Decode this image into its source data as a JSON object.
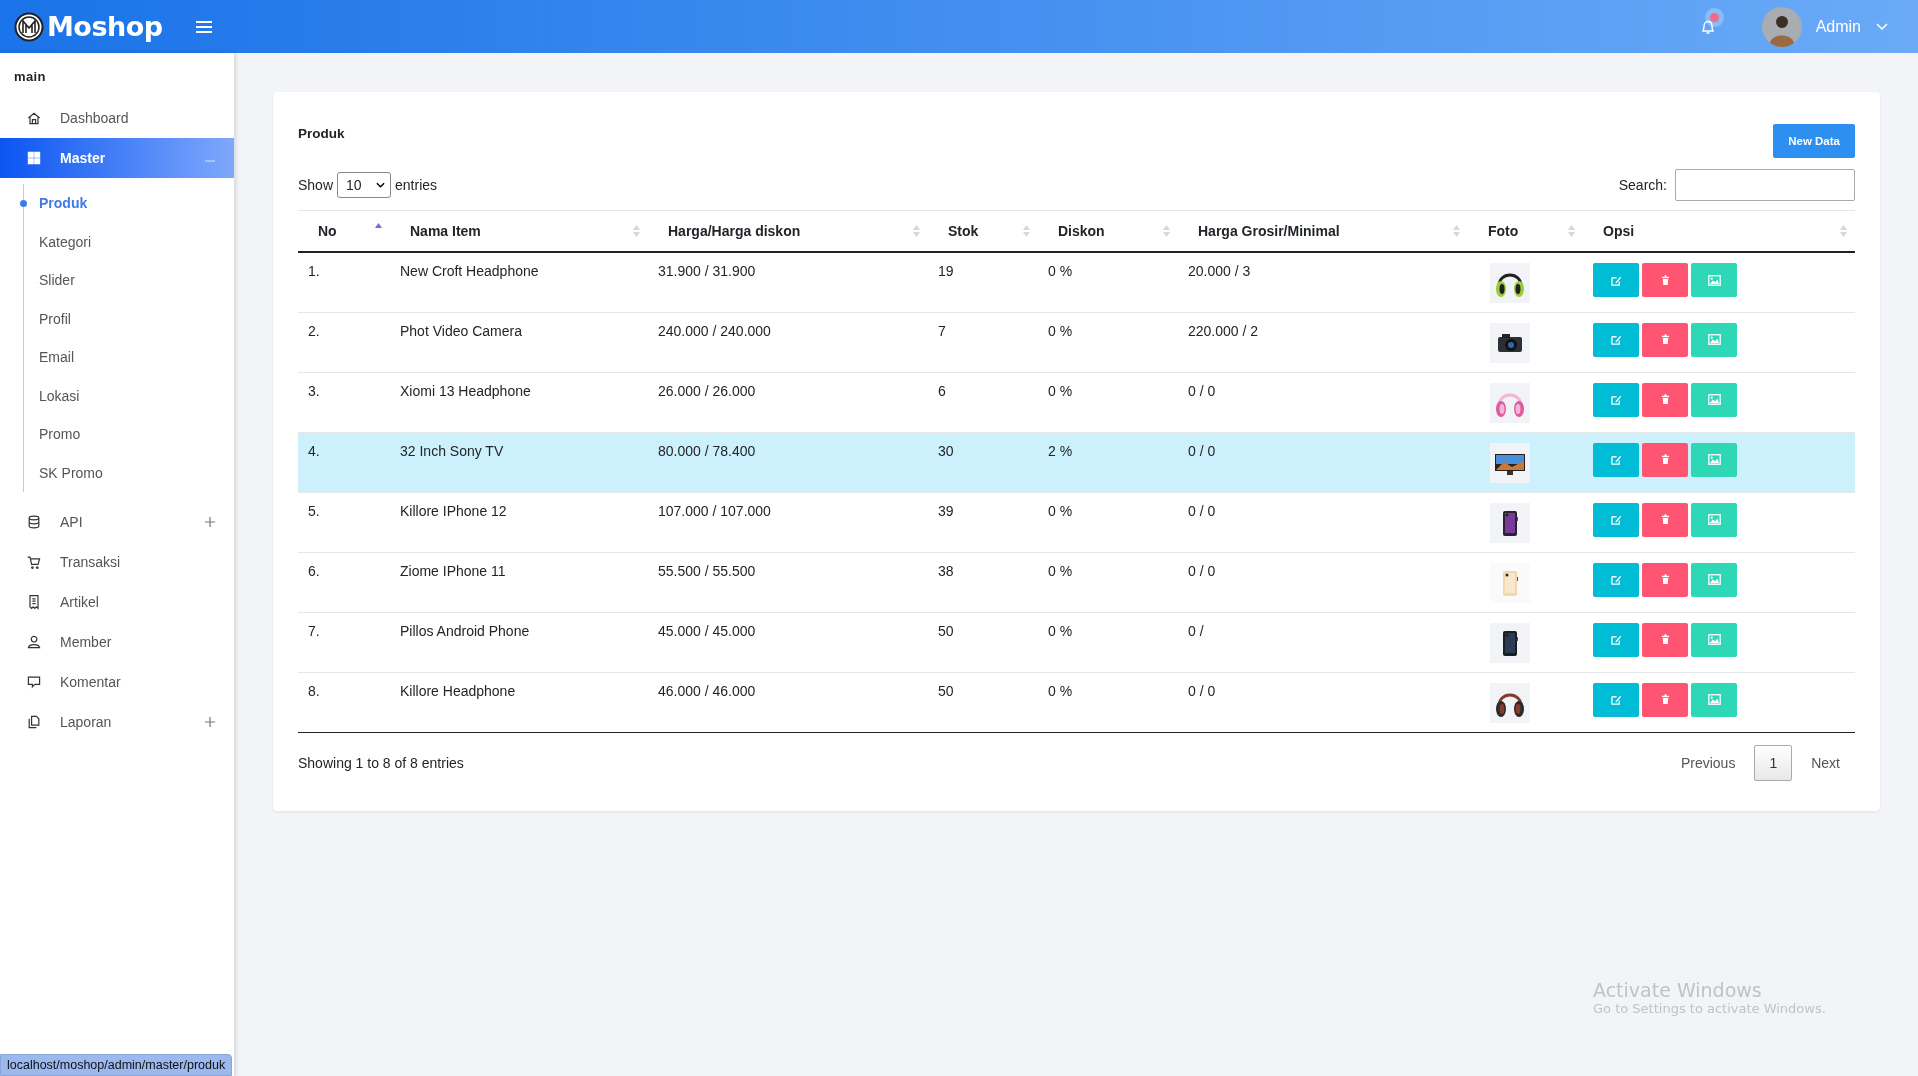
{
  "header": {
    "logo_text": "Moshop",
    "user_name": "Admin",
    "notification_unread": true
  },
  "sidebar": {
    "section_label": "main",
    "items": [
      {
        "label": "Dashboard",
        "selected": false
      },
      {
        "label": "Master",
        "selected": true,
        "expanded": true,
        "children": [
          {
            "label": "Produk",
            "selected": true
          },
          {
            "label": "Kategori",
            "selected": false
          },
          {
            "label": "Slider",
            "selected": false
          },
          {
            "label": "Profil",
            "selected": false
          },
          {
            "label": "Email",
            "selected": false
          },
          {
            "label": "Lokasi",
            "selected": false
          },
          {
            "label": "Promo",
            "selected": false
          },
          {
            "label": "SK Promo",
            "selected": false
          }
        ]
      },
      {
        "label": "API",
        "selected": false,
        "expanded": false
      },
      {
        "label": "Transaksi",
        "selected": false
      },
      {
        "label": "Artikel",
        "selected": false
      },
      {
        "label": "Member",
        "selected": false
      },
      {
        "label": "Komentar",
        "selected": false
      },
      {
        "label": "Laporan",
        "selected": false,
        "expanded": false
      }
    ]
  },
  "card": {
    "title": "Produk",
    "new_button": "New Data",
    "length_before": "Show",
    "length_value": "10",
    "length_after": "entries",
    "search_label": "Search:",
    "columns": [
      {
        "label": "No",
        "sorted": true
      },
      {
        "label": "Nama Item",
        "sorted": false
      },
      {
        "label": "Harga/Harga diskon",
        "sorted": false
      },
      {
        "label": "Stok",
        "sorted": false
      },
      {
        "label": "Diskon",
        "sorted": false
      },
      {
        "label": "Harga Grosir/Minimal",
        "sorted": false
      },
      {
        "label": "Foto",
        "sorted": false
      },
      {
        "label": "Opsi",
        "sorted": false
      }
    ],
    "rows": [
      {
        "no": "1.",
        "name": "New Croft Headphone",
        "price": "31.900 / 31.900",
        "stock": "19",
        "discount": "0 %",
        "wholesale": "20.000 / 3",
        "selected": false
      },
      {
        "no": "2.",
        "name": "Phot Video Camera",
        "price": "240.000 / 240.000",
        "stock": "7",
        "discount": "0 %",
        "wholesale": "220.000 / 2",
        "selected": false
      },
      {
        "no": "3.",
        "name": "Xiomi 13 Headphone",
        "price": "26.000 / 26.000",
        "stock": "6",
        "discount": "0 %",
        "wholesale": "0 / 0",
        "selected": false
      },
      {
        "no": "4.",
        "name": "32 Inch Sony TV",
        "price": "80.000 / 78.400",
        "stock": "30",
        "discount": "2 %",
        "wholesale": "0 / 0",
        "selected": true
      },
      {
        "no": "5.",
        "name": "Killore IPhone 12",
        "price": "107.000 / 107.000",
        "stock": "39",
        "discount": "0 %",
        "wholesale": "0 / 0",
        "selected": false
      },
      {
        "no": "6.",
        "name": "Ziome IPhone 11",
        "price": "55.500 / 55.500",
        "stock": "38",
        "discount": "0 %",
        "wholesale": "0 / 0",
        "selected": false
      },
      {
        "no": "7.",
        "name": "Pillos Android Phone",
        "price": "45.000 / 45.000",
        "stock": "50",
        "discount": "0 %",
        "wholesale": "0 /",
        "selected": false
      },
      {
        "no": "8.",
        "name": "Killore Headphone",
        "price": "46.000 / 46.000",
        "stock": "50",
        "discount": "0 %",
        "wholesale": "0 / 0",
        "selected": false
      }
    ],
    "info": "Showing 1 to 8 of 8 entries",
    "pagination": [
      {
        "label": "Previous",
        "selected": false
      },
      {
        "label": "1",
        "selected": true
      },
      {
        "label": "Next",
        "selected": false
      }
    ]
  },
  "status_url": "localhost/moshop/admin/master/produk",
  "os_notice": {
    "title": "Activate Windows",
    "subtitle": "Go to Settings to activate Windows."
  }
}
